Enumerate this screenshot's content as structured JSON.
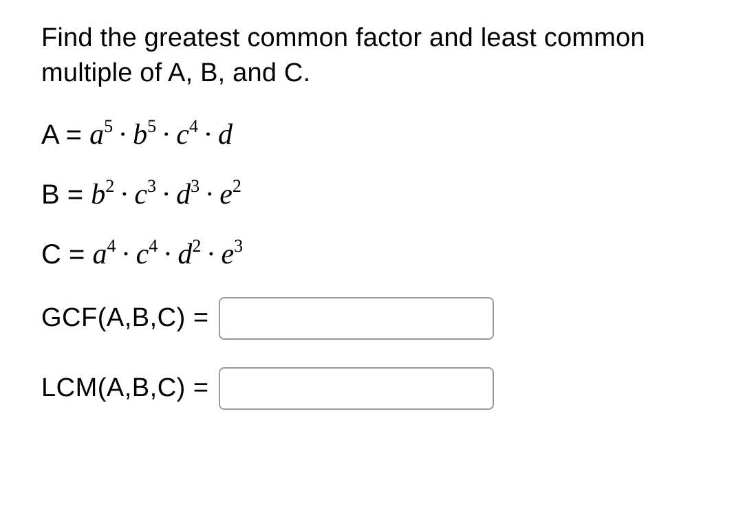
{
  "prompt": "Find the greatest common factor and least common multiple of A, B, and C.",
  "equations": {
    "A": {
      "lhs": "A = ",
      "terms": [
        {
          "base": "a",
          "exp": "5"
        },
        {
          "base": "b",
          "exp": "5"
        },
        {
          "base": "c",
          "exp": "4"
        },
        {
          "base": "d",
          "exp": ""
        }
      ]
    },
    "B": {
      "lhs": "B = ",
      "terms": [
        {
          "base": "b",
          "exp": "2"
        },
        {
          "base": "c",
          "exp": "3"
        },
        {
          "base": "d",
          "exp": "3"
        },
        {
          "base": "e",
          "exp": "2"
        }
      ]
    },
    "C": {
      "lhs": "C = ",
      "terms": [
        {
          "base": "a",
          "exp": "4"
        },
        {
          "base": "c",
          "exp": "4"
        },
        {
          "base": "d",
          "exp": "2"
        },
        {
          "base": "e",
          "exp": "3"
        }
      ]
    }
  },
  "answers": {
    "gcf": {
      "label": "GCF(A,B,C) =",
      "value": ""
    },
    "lcm": {
      "label": "LCM(A,B,C) =",
      "value": ""
    }
  },
  "dot": "·"
}
